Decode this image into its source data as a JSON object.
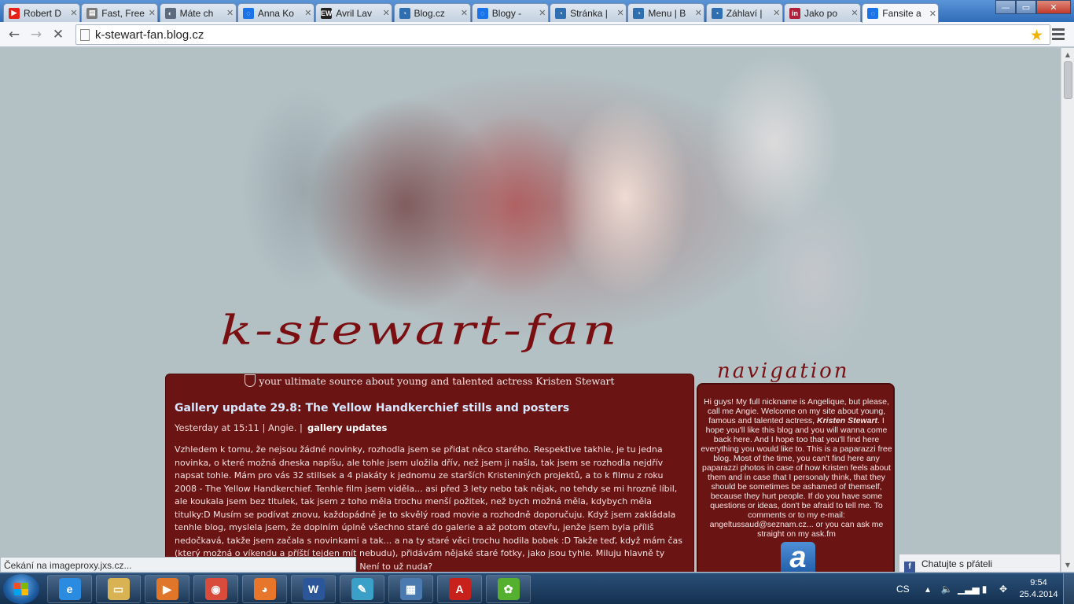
{
  "browser": {
    "tabs": [
      {
        "label": "Robert D",
        "icon": "youtube-icon",
        "color": "#e62117",
        "glyph": "▶"
      },
      {
        "label": "Fast, Free",
        "icon": "document-icon",
        "color": "#7a7a7a",
        "glyph": "▤"
      },
      {
        "label": "Máte ch",
        "icon": "blogcz-icon",
        "color": "#5b6b7d",
        "glyph": "◐"
      },
      {
        "label": "Anna Ko",
        "icon": "loading-icon",
        "color": "#1a73e8",
        "glyph": "◌"
      },
      {
        "label": "Avril Lav",
        "icon": "ew-icon",
        "color": "#222222",
        "glyph": "EW"
      },
      {
        "label": "Blog.cz",
        "icon": "blogcz-icon",
        "color": "#2f6fb0",
        "glyph": "◔"
      },
      {
        "label": "Blogy - ",
        "icon": "loading-icon",
        "color": "#1a73e8",
        "glyph": "◌"
      },
      {
        "label": "Stránka |",
        "icon": "blogcz-icon",
        "color": "#2f6fb0",
        "glyph": "◔"
      },
      {
        "label": "Menu | B",
        "icon": "blogcz-icon",
        "color": "#2f6fb0",
        "glyph": "◔"
      },
      {
        "label": "Záhlaví |",
        "icon": "blogcz-icon",
        "color": "#2f6fb0",
        "glyph": "◔"
      },
      {
        "label": "Jako po",
        "icon": "linkedin-icon",
        "color": "#b01e3a",
        "glyph": "in"
      },
      {
        "label": "Fansite a",
        "icon": "loading-icon",
        "color": "#1a73e8",
        "glyph": "◌"
      }
    ],
    "url": "k-stewart-fan.blog.cz",
    "status_text": "Čekání na imageproxy.jxs.cz..."
  },
  "site": {
    "logo": "k-stewart-fan",
    "tagline": "your ultimate source about young and talented actress Kristen Stewart",
    "nav_title": "navigation",
    "post": {
      "title": "Gallery update 29.8: The Yellow Handkerchief stills and posters",
      "meta": "Yesterday at 15:11 | Angie. |",
      "category": "gallery updates",
      "body": "Vzhledem k tomu, že nejsou žádné novinky, rozhodla jsem se přidat něco starého. Respektive takhle, je tu jedna novinka, o které možná dneska napíšu, ale tohle jsem uložila dřív, než jsem ji našla, tak jsem se rozhodla nejdřív napsat tohle. Mám pro vás 32 stillsek a 4 plakáty k jednomu ze starších Kristeniných projektů, a to k filmu z roku 2008 - The Yellow Handkerchief. Tenhle film jsem viděla... asi před 3 lety nebo tak nějak, no tehdy se mi hrozně líbil, ale koukala jsem bez titulek, tak jsem z toho měla trochu menší požitek, než bych možná měla, kdybych měla titulky:D Musím se podívat znovu, každopádně je to skvělý road movie a rozhodně doporučuju. Když jsem zakládala tenhle blog, myslela jsem, že doplním úplně všechno staré do galerie a až potom otevřu, jenže jsem byla příliš nedočkavá, takže jsem začala s novinkami a tak... a na ty staré věci trochu hodila bobek :D Takže teď, když mám čas (který možná o víkendu a příští tejden mít nebudu), přidávám nějaké staré fotky, jako jsou tyhle. Miluju hlavně ty stillsky, uvažuju m ten aktuální pořád líbí? Není to už nuda?"
    },
    "sidebar": {
      "intro": "Hi guys! My full nickname is Angelique, but please, call me Angie. Welcome on my site about young, famous and talented actress,",
      "intro_name": "Kristen Stewart",
      "intro_rest": ". I hope you'll like this blog and you will wanna come back here. And I hope too that you'll find here everything you would like to. This is a paparazzi free blog. Most of the time, you can't find here any paparazzi photos in case of how Kristen feels about them and in case that I personaly think, that they should be sometimes be ashamed of themself, because they hurt people. If do you have some questions or ideas, don't be afraid to tell me. To comments or to my e-mail: angeltussaud@seznam.cz... or you can ask me straight on my ask.fm",
      "askfm_letter": "a"
    },
    "chat_label": "Chatujte s přáteli"
  },
  "taskbar": {
    "apps": [
      {
        "name": "internet-explorer-icon",
        "glyph": "e",
        "color": "#2a8be0"
      },
      {
        "name": "file-explorer-icon",
        "glyph": "▭",
        "color": "#d9b253"
      },
      {
        "name": "media-player-icon",
        "glyph": "▶",
        "color": "#e0762a"
      },
      {
        "name": "chrome-icon",
        "glyph": "◉",
        "color": "#d94b3a"
      },
      {
        "name": "firefox-icon",
        "glyph": "◕",
        "color": "#e8762a"
      },
      {
        "name": "word-icon",
        "glyph": "W",
        "color": "#2b579a"
      },
      {
        "name": "feather-app-icon",
        "glyph": "✎",
        "color": "#3aa0c8"
      },
      {
        "name": "network-app-icon",
        "glyph": "▦",
        "color": "#4a7ab0"
      },
      {
        "name": "acrobat-icon",
        "glyph": "A",
        "color": "#c8201a"
      },
      {
        "name": "icq-icon",
        "glyph": "✿",
        "color": "#55b030"
      }
    ],
    "language": "CS",
    "time": "9:54",
    "date": "25.4.2014"
  }
}
